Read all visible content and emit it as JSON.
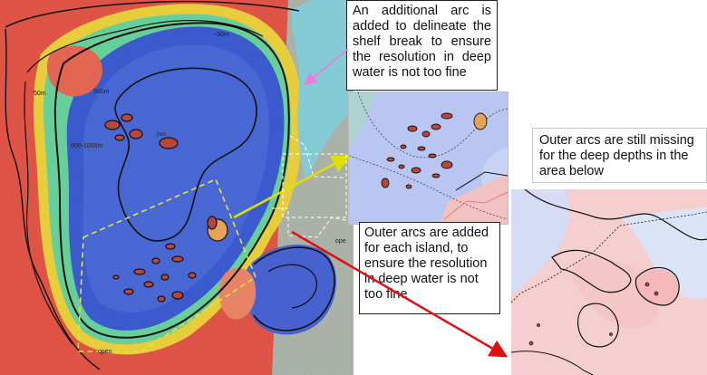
{
  "callouts": {
    "shelf_break": "An additional arc is added to delineate the shelf break to ensure the resolution in deep water is not too fine",
    "islands": "Outer arcs are added for each island, to ensure the resolution in deep water is not too fine",
    "outer_missing": "Outer arcs are still missing for the deep depths in the area below"
  },
  "map_labels": {
    "top_right": "~50m",
    "left_50m": "50m",
    "depth_500m": "500m",
    "depth_600_1000m": "600-1000m",
    "depth_2km": "2km",
    "open_bottom": "open",
    "open_right": "ope"
  },
  "colors": {
    "shallow": "#e8392f",
    "mid": "#f5d33a",
    "transition": "#52d5a0",
    "deep": "#3f5fd8",
    "contour": "#111111",
    "dashed_box": "#e8e23a",
    "arrow_green": "#e0e000",
    "arrow_red": "#e01010",
    "arrow_pink": "#e680d8"
  }
}
